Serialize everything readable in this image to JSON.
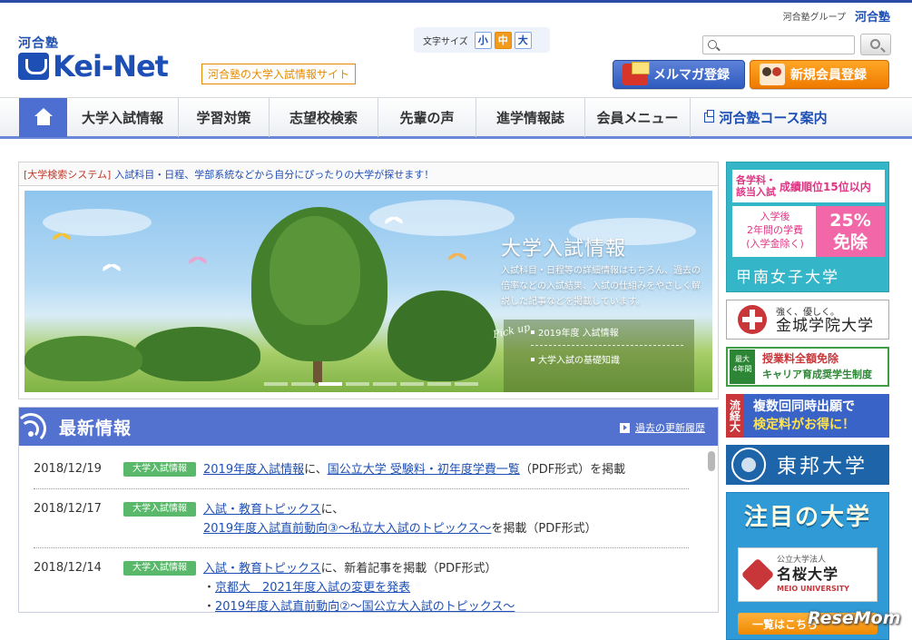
{
  "group_bar": {
    "label": "河合塾グループ",
    "brand": "河合塾"
  },
  "header": {
    "logo_small": "河合塾",
    "logo_main": "Kei-Net",
    "tagline": "河合塾の大学入試情報サイト",
    "font_size": {
      "label": "文字サイズ",
      "small": "小",
      "medium": "中",
      "large": "大",
      "active": "medium"
    },
    "search": {
      "placeholder": ""
    },
    "mail_button": "メルマガ登録",
    "register_button": "新規会員登録"
  },
  "nav": {
    "items": [
      "大学入試情報",
      "学習対策",
      "志望校検索",
      "先輩の声",
      "進学情報誌",
      "会員メニュー"
    ],
    "external": "河合塾コース案内"
  },
  "system_bar": {
    "tag": "[大学検索システム]",
    "text": "入試科目・日程、学部系統などから自分にぴったりの大学が探せます！"
  },
  "hero": {
    "title": "大学入試情報",
    "description": "入試科目・日程等の詳細情報はもちろん、過去の倍率などの入試結果、入試の仕組みをやさしく解説した記事などを掲載しています。",
    "pickup_label": "Pick up",
    "links": [
      "2019年度 入試情報",
      "大学入試の基礎知識"
    ],
    "slide_count": 8,
    "active_slide": 3
  },
  "news": {
    "title": "最新情報",
    "more": "過去の更新履歴",
    "items": [
      {
        "date": "2018/12/19",
        "tag": "大学入試情報",
        "link1": "2019年度入試情報",
        "mid": "に、",
        "link2": "国公立大学 受験料・初年度学費一覧",
        "tail": "（PDF形式）を掲載"
      },
      {
        "date": "2018/12/17",
        "tag": "大学入試情報",
        "link1": "入試・教育トピックス",
        "mid": "に、",
        "link2": "2019年度入試直前動向③〜私立大入試のトピックス〜",
        "tail": "を掲載（PDF形式）"
      },
      {
        "date": "2018/12/14",
        "tag": "大学入試情報",
        "link1": "入試・教育トピックス",
        "mid": "に、新着記事を掲載（PDF形式）",
        "bullets": [
          "京都大　2021年度入試の変更を発表",
          "2019年度入試直前動向②〜国公立大入試のトピックス〜"
        ]
      }
    ]
  },
  "sidebar": {
    "konan": {
      "row1_left": "各学科・\n該当入試",
      "row1_right": "成績順位15位以内",
      "row2_left": "入学後\n2年間の学費\n(入学金除く)",
      "row2_right": "25%\n免除",
      "school": "甲南女子大学"
    },
    "kinjo": {
      "catch": "強く、優しく。",
      "school": "金城学院大学"
    },
    "tuition": {
      "badge": "最大\n4年間",
      "line1": "授業料全額免除",
      "line2": "キャリア育成奨学生制度"
    },
    "ryukei": {
      "tag": "流経大",
      "line1": "複数回同時出願で",
      "line2": "検定料がお得に！"
    },
    "toho": {
      "school": "東邦大学"
    },
    "feature": {
      "title": "注目の大学",
      "kind": "公立大学法人",
      "school": "名桜大学",
      "school_en": "MEIO UNIVERSITY",
      "list_button": "一覧はこちら"
    }
  },
  "watermark": "ReseMom"
}
